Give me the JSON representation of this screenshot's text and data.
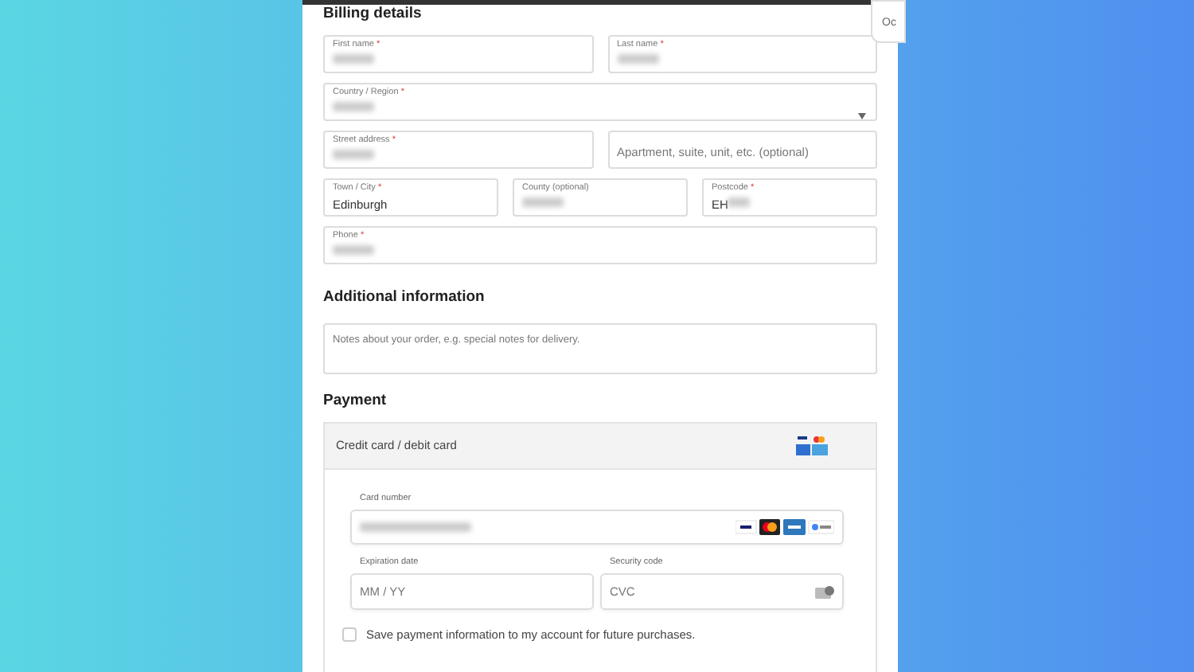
{
  "side_card": {
    "text": "Oc"
  },
  "billing": {
    "title": "Billing details",
    "rows": [
      [
        {
          "kind": "text",
          "label": "First name",
          "mark": "*",
          "blurred": true
        },
        {
          "kind": "text",
          "label": "Last name",
          "mark": "*",
          "blurred": true
        }
      ],
      [
        {
          "kind": "select",
          "label": "Country / Region",
          "mark": "*",
          "blurred": true
        }
      ],
      [
        {
          "kind": "text",
          "label": "Street address",
          "mark": "*",
          "blurred": true
        },
        {
          "kind": "text",
          "placeholder": "Apartment, suite, unit, etc. (optional)"
        }
      ],
      [
        {
          "kind": "text",
          "label": "Town / City",
          "mark": "*",
          "value": "Edinburgh"
        },
        {
          "kind": "text",
          "label": "County (optional)",
          "blurred": true
        },
        {
          "kind": "text",
          "label": "Postcode",
          "mark": "*",
          "value": "EH",
          "blurred": true
        }
      ],
      [
        {
          "kind": "text",
          "label": "Phone",
          "mark": "*",
          "blurred": true
        }
      ]
    ]
  },
  "additional": {
    "title": "Additional information",
    "placeholder": "Notes about your order, e.g. special notes for delivery."
  },
  "payment": {
    "title": "Payment",
    "method": "Credit card / debit card",
    "card_number": {
      "label": "Card number",
      "blurred": true
    },
    "expiry": {
      "label": "Expiration date",
      "placeholder": "MM / YY"
    },
    "security": {
      "label": "Security code",
      "placeholder": "CVC"
    },
    "save": {
      "label": "Save payment information to my account for future purchases.",
      "checked": false
    }
  }
}
